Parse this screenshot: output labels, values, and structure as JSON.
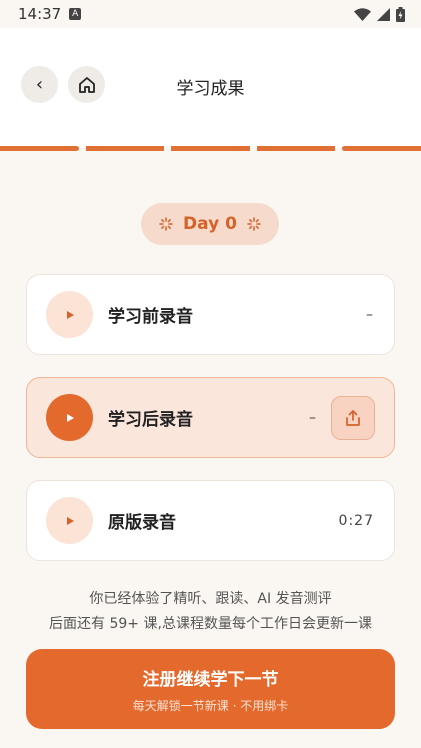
{
  "status_bar": {
    "time": "14:37",
    "a_icon_label": "A"
  },
  "header": {
    "back_label": "‹",
    "title": "学习成果"
  },
  "progress": {
    "segments": 5,
    "completed": 5
  },
  "day_badge": {
    "label": "Day 0"
  },
  "recordings": [
    {
      "title": "学习前录音",
      "value": "–"
    },
    {
      "title": "学习后录音",
      "value": "–"
    },
    {
      "title": "原版录音",
      "value": "0:27"
    }
  ],
  "info": {
    "line1": "你已经体验了精听、跟读、AI 发音测评",
    "line2": "后面还有 59+ 课,总课程数量每个工作日会更新一课"
  },
  "cta": {
    "title": "注册继续学下一节",
    "subtitle": "每天解锁一节新课 · 不用绑卡"
  },
  "colors": {
    "accent": "#e4692d",
    "accent_light": "#fbe3d6",
    "background": "#faf6f1"
  }
}
